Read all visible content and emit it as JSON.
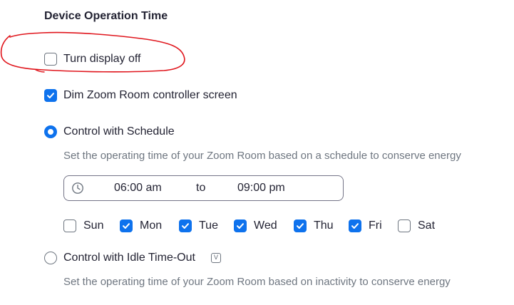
{
  "section": {
    "title": "Device Operation Time"
  },
  "options": {
    "turn_display_off": {
      "label": "Turn display off",
      "checked": false
    },
    "dim_controller": {
      "label": "Dim Zoom Room controller screen",
      "checked": true
    }
  },
  "schedule": {
    "label": "Control with Schedule",
    "selected": true,
    "description": "Set the operating time of your Zoom Room based on a schedule to conserve energy",
    "start_time": "06:00 am",
    "separator": "to",
    "end_time": "09:00 pm",
    "days": [
      {
        "label": "Sun",
        "checked": false
      },
      {
        "label": "Mon",
        "checked": true
      },
      {
        "label": "Tue",
        "checked": true
      },
      {
        "label": "Wed",
        "checked": true
      },
      {
        "label": "Thu",
        "checked": true
      },
      {
        "label": "Fri",
        "checked": true
      },
      {
        "label": "Sat",
        "checked": false
      }
    ]
  },
  "idle_timeout": {
    "label": "Control with Idle Time-Out",
    "selected": false,
    "badge_icon": "v-badge-icon",
    "badge_text": "V",
    "description": "Set the operating time of your Zoom Room based on inactivity to conserve energy"
  },
  "colors": {
    "accent": "#0e72ed",
    "annotation": "#e0161d",
    "text": "#232333",
    "muted": "#6e7680"
  }
}
